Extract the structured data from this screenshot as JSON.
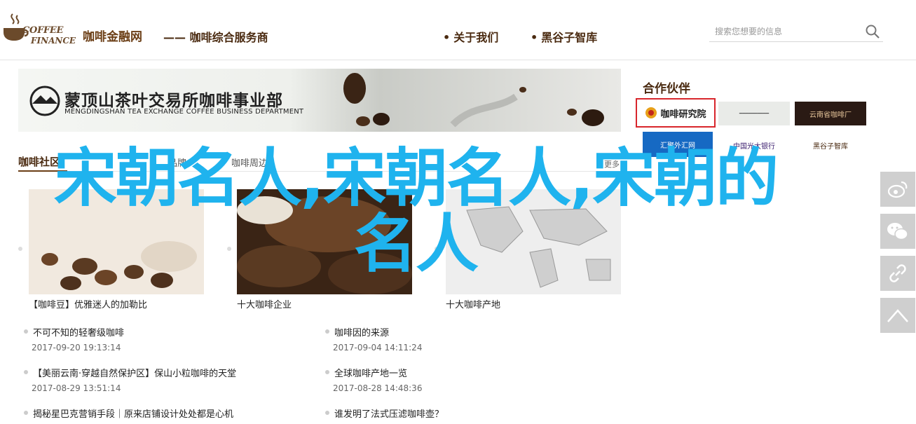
{
  "header": {
    "logo_line1": "COFFEE",
    "logo_line2": "FINANCE",
    "site_title": "咖啡金融网",
    "site_sub": "—— 咖啡综合服务商",
    "nav": [
      "关于我们",
      "黑谷子智库"
    ],
    "search_placeholder": "搜索您想要的信息"
  },
  "banner": {
    "title": "蒙顶山茶叶交易所咖啡事业部",
    "subtitle": "MENGDINGSHAN TEA EXCHANGE COFFEE BUSINESS DEPARTMENT"
  },
  "partners": {
    "title": "合作伙伴",
    "logos": [
      "咖啡研究院",
      "云南省咖啡厂",
      "汇聚外汇网",
      "中国光大银行",
      "黑谷子智库"
    ]
  },
  "section": {
    "title": "咖啡社区",
    "tabs": [
      "品牌",
      "咖啡周边"
    ],
    "more": "更多",
    "cards": [
      {
        "caption": "【咖啡豆】优雅迷人的加勒比"
      },
      {
        "caption": "十大咖啡企业"
      },
      {
        "caption": "十大咖啡产地"
      }
    ],
    "list_left": [
      {
        "title": "不可不知的轻奢级咖啡",
        "date": "2017-09-20 19:13:14"
      },
      {
        "title": "【美丽云南·穿越自然保护区】保山小粒咖啡的天堂",
        "date": "2017-08-29 13:51:14"
      },
      {
        "title": "揭秘星巴克营销手段｜原来店铺设计处处都是心机",
        "date": ""
      }
    ],
    "list_right": [
      {
        "title": "咖啡因的来源",
        "date": "2017-09-04 14:11:24"
      },
      {
        "title": "全球咖啡产地一览",
        "date": "2017-08-28 14:48:36"
      },
      {
        "title": "谁发明了法式压滤咖啡壶？",
        "date": ""
      }
    ]
  },
  "overlay": {
    "headline": "宋朝名人,宋朝名人,宋朝的名人"
  },
  "share": [
    "weibo-icon",
    "wechat-icon",
    "link-icon",
    "back-to-top-icon"
  ],
  "colors": {
    "brand": "#4a2a10",
    "overlay": "#1fb3ee"
  }
}
